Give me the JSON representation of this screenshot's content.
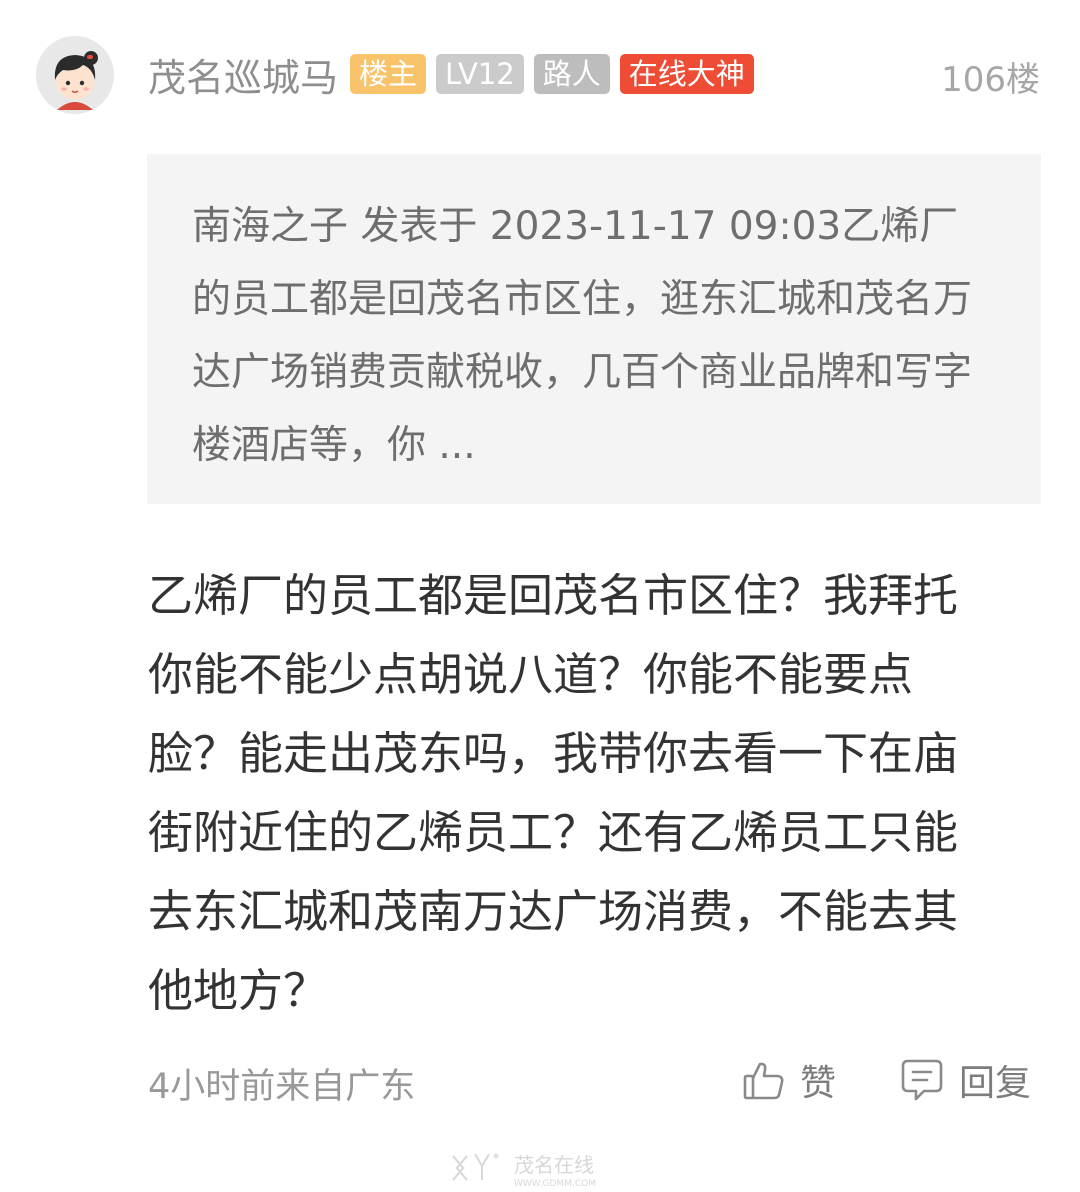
{
  "post": {
    "author": {
      "name": "茂名巡城马",
      "badges": [
        {
          "label": "楼主",
          "color": "#f8c36b"
        },
        {
          "label": "LV12",
          "color": "#cbcbcb"
        },
        {
          "label": "路人",
          "color": "#bdbdbd"
        },
        {
          "label": "在线大神",
          "color": "#ee4c34"
        }
      ],
      "avatar": "cartoon-girl-avatar-icon"
    },
    "floor": "106楼",
    "quote": {
      "text": "南海之子 发表于 2023-11-17 09:03乙烯厂的员工都是回茂名市区住，逛东汇城和茂名万达广场销费贡献税收，几百个商业品牌和写字楼酒店等，你 ..."
    },
    "content": "乙烯厂的员工都是回茂名市区住？我拜托你能不能少点胡说八道？你能不能要点脸？能走出茂东吗，我带你去看一下在庙街附近住的乙烯员工？还有乙烯员工只能去东汇城和茂南万达广场消费，不能去其他地方？",
    "meta": "4小时前来自广东",
    "actions": {
      "like_label": "赞",
      "reply_label": "回复"
    }
  },
  "watermark": {
    "brand": "茂名在线",
    "url": "WWW.GDMM.COM"
  },
  "colors": {
    "quote_background": "#f4f4f4",
    "body_text": "#333333",
    "muted_text": "#999999"
  }
}
